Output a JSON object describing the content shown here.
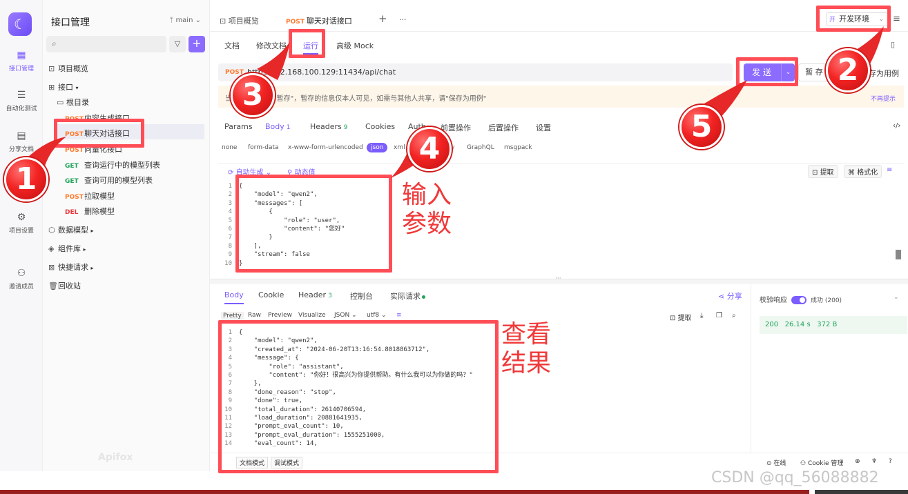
{
  "rail": {
    "items": [
      {
        "label": "接口管理",
        "icon": "api-icon"
      },
      {
        "label": "自动化测试",
        "icon": "automation-icon"
      },
      {
        "label": "分享文档",
        "icon": "share-doc-icon"
      },
      {
        "label": "项目设置",
        "icon": "settings-icon"
      },
      {
        "label": "邀请成员",
        "icon": "invite-icon"
      }
    ]
  },
  "sidebar": {
    "title": "接口管理",
    "branch": "main",
    "tree": {
      "overview": "项目概览",
      "interfaces": "接口",
      "root": "根目录",
      "endpoints": [
        {
          "method": "POST",
          "name": "内容生成接口"
        },
        {
          "method": "POST",
          "name": "聊天对话接口"
        },
        {
          "method": "POST",
          "name": "向量化接口"
        },
        {
          "method": "GET",
          "name": "查询运行中的模型列表"
        },
        {
          "method": "GET",
          "name": "查询可用的模型列表"
        },
        {
          "method": "POST",
          "name": "拉取模型"
        },
        {
          "method": "DEL",
          "name": "删除模型"
        }
      ],
      "data_models": "数据模型",
      "components": "组件库",
      "quick_requests": "快捷请求",
      "recycle": "回收站"
    },
    "brand": "Apifox"
  },
  "tabs": {
    "overview": "项目概览",
    "active_method": "POST",
    "active_name": "聊天对话接口",
    "add": "+",
    "more": "···"
  },
  "env": {
    "badge": "开",
    "label": "开发环境"
  },
  "subtabs": [
    "文档",
    "修改文档",
    "运行",
    "高级 Mock"
  ],
  "request": {
    "method": "POST",
    "url": "http://192.168.100.129:11434/api/chat",
    "send": "发 送",
    "save": "暂 存",
    "save_as": "存为用例"
  },
  "notice": {
    "text": "当前修改已自动\"暂存\"，暂存的信息仅本人可见，如需与其他人共享，请\"保存为用例\"",
    "dismiss": "不再提示"
  },
  "param_tabs": [
    {
      "label": "Params",
      "count": ""
    },
    {
      "label": "Body",
      "count": "1"
    },
    {
      "label": "Headers",
      "count": "9"
    },
    {
      "label": "Cookies",
      "count": ""
    },
    {
      "label": "Auth",
      "count": ""
    },
    {
      "label": "前置操作",
      "count": ""
    },
    {
      "label": "后置操作",
      "count": ""
    },
    {
      "label": "设置",
      "count": ""
    }
  ],
  "body_types": [
    "none",
    "form-data",
    "x-www-form-urlencoded",
    "json",
    "xml",
    "raw",
    "binary",
    "GraphQL",
    "msgpack"
  ],
  "editor_tools": {
    "auto": "自动生成",
    "dynamic": "动态值",
    "extract": "提取",
    "format": "格式化"
  },
  "request_body": [
    "{",
    "    \"model\": \"qwen2\",",
    "    \"messages\": [",
    "        {",
    "            \"role\": \"user\",",
    "            \"content\": \"您好\"",
    "        }",
    "    ],",
    "    \"stream\": false",
    "}"
  ],
  "response_tabs": [
    {
      "label": "Body",
      "count": ""
    },
    {
      "label": "Cookie",
      "count": ""
    },
    {
      "label": "Header",
      "count": "3"
    },
    {
      "label": "控制台",
      "count": ""
    },
    {
      "label": "实际请求",
      "count": ""
    }
  ],
  "share": "分享",
  "response_formats": [
    "Pretty",
    "Raw",
    "Preview",
    "Visualize",
    "JSON",
    "utf8"
  ],
  "response_tools": {
    "extract": "提取"
  },
  "response_body": [
    "{",
    "    \"model\": \"qwen2\",",
    "    \"created_at\": \"2024-06-20T13:16:54.8018863712\",",
    "    \"message\": {",
    "        \"role\": \"assistant\",",
    "        \"content\": \"你好！很高兴为你提供帮助。有什么我可以为你做的吗？\"",
    "    },",
    "    \"done_reason\": \"stop\",",
    "    \"done\": true,",
    "    \"total_duration\": 26140706594,",
    "    \"load_duration\": 20881641935,",
    "    \"prompt_eval_count\": 10,",
    "    \"prompt_eval_duration\": 1555251000,",
    "    \"eval_count\": 14,"
  ],
  "verify": {
    "label": "校验响应",
    "status": "成功 (200)",
    "code": "200",
    "time": "26.14 s",
    "size": "372 B"
  },
  "bottom": {
    "doc_mode": "文档模式",
    "debug_mode": "调试模式",
    "online": "在线",
    "cookie": "Cookie 管理"
  },
  "annotations": {
    "n1": "1",
    "n2": "2",
    "n3": "3",
    "n4": "4",
    "n5": "5",
    "input_params": "输入\n参数",
    "view_result": "查看\n结果"
  },
  "watermark": "CSDN @qq_56088882",
  "colors": {
    "accent": "#7b5cff",
    "annotation": "#f03a3a",
    "post": "#ff7a2d",
    "get": "#20a35b",
    "del": "#e8383d"
  }
}
